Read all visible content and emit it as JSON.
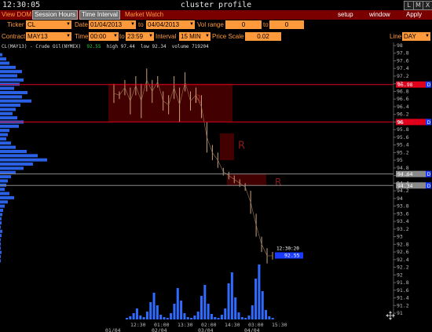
{
  "titlebar": {
    "clock": "12:30:05",
    "title": "cluster profile",
    "buttons": [
      "L",
      "M",
      "X"
    ]
  },
  "menubar": {
    "tabs": [
      "View DOM",
      "Session Hours",
      "Time Interval",
      "Market Watch"
    ],
    "right": [
      "setup",
      "window",
      "Apply"
    ]
  },
  "params": {
    "ticker_label": "Ticker",
    "ticker": "CL",
    "date_label": "Date",
    "date_from": "01/04/2013",
    "to_label": "to",
    "date_to": "04/04/2013",
    "vol_label": "Vol range",
    "vol_from": "0",
    "vol_to_label": "to",
    "vol_to": "0",
    "contract_label": "Contract",
    "contract": "MAY13",
    "time_label": "Time",
    "time_from": "00:00",
    "time_to_label": "to",
    "time_to": "23:59",
    "interval_label": "Interval",
    "interval": "15 MIN",
    "price_scale_label": "Price Scale",
    "price_scale": "0.02",
    "line_label": "Line",
    "line": "DAY"
  },
  "chart_header": {
    "symbol": "CL(MAY13) - Crude Oil(NYMEX)",
    "last": "92.55",
    "high": "high 97.44",
    "low": "low 92.34",
    "volume": "volume 719204"
  },
  "chart_data": {
    "type": "line",
    "price_axis": [
      "98",
      "97.8",
      "97.6",
      "97.4",
      "97.2",
      "97",
      "96.8",
      "96.6",
      "96.4",
      "96.2",
      "96",
      "95.8",
      "95.6",
      "95.4",
      "95.2",
      "95",
      "94.8",
      "94.6",
      "94.4",
      "94.2",
      "94",
      "93.8",
      "93.6",
      "93.4",
      "93.2",
      "93",
      "92.8",
      "92.6",
      "92.4",
      "92.2",
      "92",
      "91.8",
      "91.6",
      "91.4",
      "91.2",
      "91"
    ],
    "time_labels": [
      "12:30",
      "01:00",
      "13:30",
      "02:00",
      "14:30",
      "03:00",
      "15:30"
    ],
    "date_labels": [
      "01/04",
      "02/04",
      "03/04",
      "04/04"
    ],
    "levels": [
      {
        "price": "96.98",
        "color": "#e0001b"
      },
      {
        "price": "96",
        "color": "#e0001b"
      },
      {
        "price": "94.64",
        "color": "#8a8a8a"
      },
      {
        "price": "94.34",
        "color": "#8a8a8a"
      }
    ],
    "level_flag": "D",
    "zone_marker": "R",
    "last_time": "12:30:20",
    "last_price": "92.55",
    "price_path": [
      [
        97.0,
        96.5
      ],
      [
        96.6,
        96.8
      ],
      [
        96.7,
        97.1
      ],
      [
        96.2,
        96.9
      ],
      [
        96.7,
        97.2
      ],
      [
        96.1,
        97.0
      ],
      [
        96.8,
        97.4
      ],
      [
        96.5,
        97.1
      ],
      [
        96.9,
        97.2
      ],
      [
        96.3,
        96.8
      ],
      [
        96.2,
        96.7
      ],
      [
        96.6,
        97.2
      ],
      [
        96.0,
        96.9
      ],
      [
        96.8,
        97.3
      ],
      [
        96.3,
        96.8
      ],
      [
        96.5,
        96.9
      ],
      [
        96.1,
        96.7
      ],
      [
        95.2,
        96.0
      ],
      [
        95.0,
        95.4
      ],
      [
        94.8,
        95.2
      ],
      [
        94.6,
        94.8
      ],
      [
        94.5,
        94.7
      ],
      [
        94.4,
        94.6
      ],
      [
        94.3,
        94.5
      ],
      [
        94.2,
        94.4
      ],
      [
        93.6,
        94.2
      ],
      [
        93.0,
        93.6
      ],
      [
        92.6,
        93.0
      ],
      [
        92.3,
        92.7
      ],
      [
        92.4,
        92.6
      ]
    ],
    "volume_bars": [
      2,
      4,
      8,
      14,
      5,
      3,
      10,
      22,
      34,
      18,
      6,
      3,
      2,
      8,
      20,
      40,
      24,
      8,
      3,
      2,
      5,
      10,
      30,
      44,
      20,
      7,
      3,
      2,
      6,
      14,
      46,
      60,
      28,
      9,
      3,
      2,
      5,
      18,
      52,
      70,
      36,
      12,
      4,
      2
    ]
  }
}
